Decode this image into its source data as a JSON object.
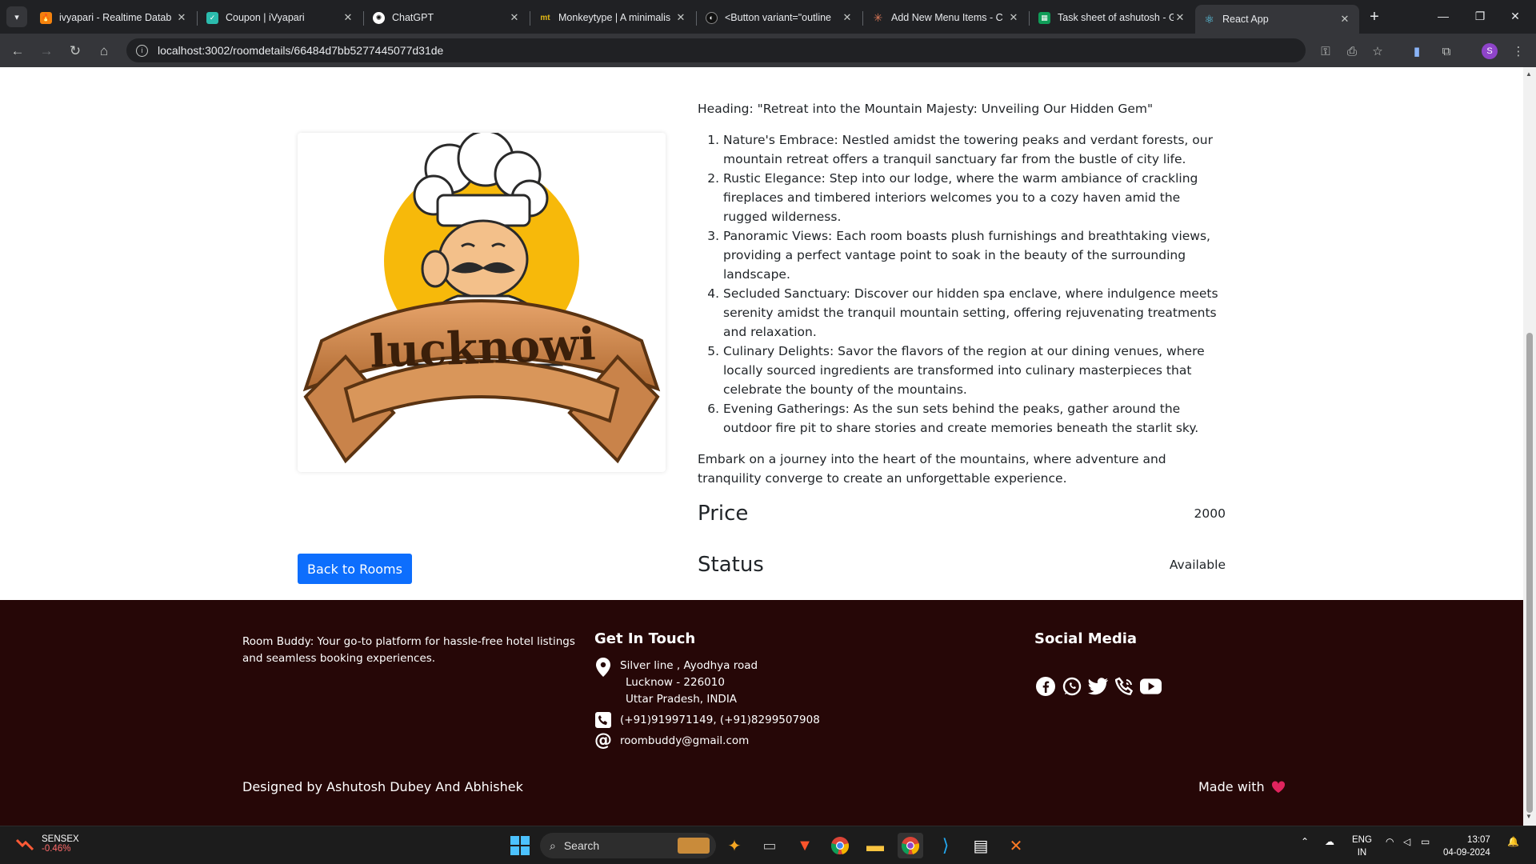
{
  "browser": {
    "tabs": [
      {
        "title": "ivyapari - Realtime Datab",
        "favicon": "firebase-icon",
        "color": "#f5820d"
      },
      {
        "title": "Coupon | iVyapari",
        "favicon": "ivyapari-icon",
        "color": "#2bbbad"
      },
      {
        "title": "ChatGPT",
        "favicon": "chatgpt-icon",
        "color": "#555"
      },
      {
        "title": "Monkeytype | A minimalis",
        "favicon": "monkeytype-icon",
        "color": "#e2b714"
      },
      {
        "title": "<Button variant=\"outline",
        "favicon": "vercel-icon",
        "color": "#444"
      },
      {
        "title": "Add New Menu Items - C",
        "favicon": "claude-icon",
        "color": "#d97757"
      },
      {
        "title": "Task sheet of ashutosh - G",
        "favicon": "sheets-icon",
        "color": "#0f9d58"
      },
      {
        "title": "React App",
        "favicon": "react-icon",
        "color": "#61dafb"
      }
    ],
    "url": "localhost:3002/roomdetails/66484d7bb5277445077d31de",
    "profile_initial": "S"
  },
  "room": {
    "image_alt": "Lucknowi",
    "logo_text": "lucknowi",
    "heading": "Heading: \"Retreat into the Mountain Majesty: Unveiling Our Hidden Gem\"",
    "features": [
      "Nature's Embrace: Nestled amidst the towering peaks and verdant forests, our mountain retreat offers a tranquil sanctuary far from the bustle of city life.",
      "Rustic Elegance: Step into our lodge, where the warm ambiance of crackling fireplaces and timbered interiors welcomes you to a cozy haven amid the rugged wilderness.",
      "Panoramic Views: Each room boasts plush furnishings and breathtaking views, providing a perfect vantage point to soak in the beauty of the surrounding landscape.",
      "Secluded Sanctuary: Discover our hidden spa enclave, where indulgence meets serenity amidst the tranquil mountain setting, offering rejuvenating treatments and relaxation.",
      "Culinary Delights: Savor the flavors of the region at our dining venues, where locally sourced ingredients are transformed into culinary masterpieces that celebrate the bounty of the mountains.",
      "Evening Gatherings: As the sun sets behind the peaks, gather around the outdoor fire pit to share stories and create memories beneath the starlit sky."
    ],
    "closing": "Embark on a journey into the heart of the mountains, where adventure and tranquility converge to create an unforgettable experience.",
    "price_label": "Price",
    "price_value": "2000",
    "status_label": "Status",
    "status_value": "Available",
    "back_button": "Back to Rooms"
  },
  "footer": {
    "about": "Room Buddy: Your go-to platform for hassle-free hotel listings and seamless booking experiences.",
    "contact_title": "Get In Touch",
    "address_lines": [
      "Silver line , Ayodhya road",
      "Lucknow - 226010",
      "Uttar Pradesh, INDIA"
    ],
    "phone": "(+91)919971149, (+91)8299507908",
    "email": "roombuddy@gmail.com",
    "social_title": "Social Media",
    "social_icons": [
      "facebook-icon",
      "whatsapp-icon",
      "twitter-icon",
      "phone-icon",
      "youtube-icon"
    ],
    "credit": "Designed by Ashutosh Dubey And Abhishek",
    "made_with": "Made with",
    "background": "#260707"
  },
  "taskbar": {
    "ticker_name": "SENSEX",
    "ticker_change": "-0.46%",
    "search_placeholder": "Search",
    "lang_top": "ENG",
    "lang_bottom": "IN",
    "time": "13:07",
    "date": "04-09-2024"
  },
  "colors": {
    "primary_button": "#0d6efd",
    "heart": "#e0245e"
  }
}
